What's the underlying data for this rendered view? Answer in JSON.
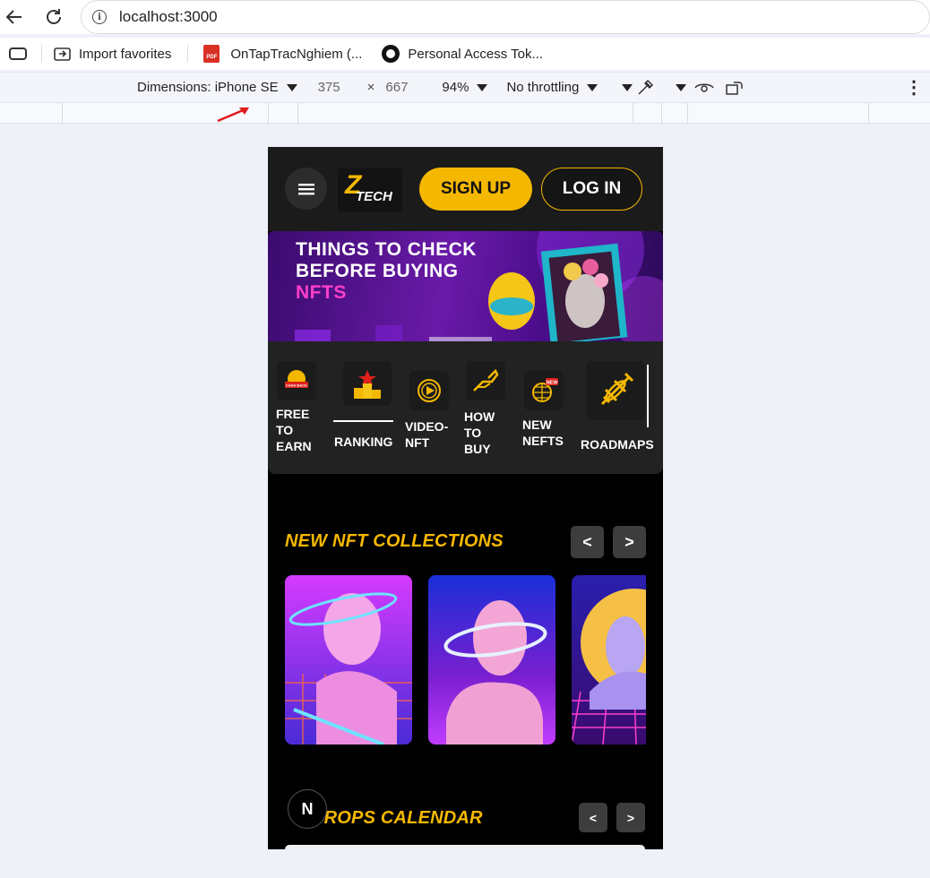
{
  "browser": {
    "url": "localhost:3000",
    "favorites": [
      "Import favorites",
      "OnTapTracNghiem (...",
      "Personal Access Tok..."
    ]
  },
  "devtools": {
    "dimensions_label": "Dimensions: iPhone SE",
    "width": "375",
    "times": "×",
    "height": "667",
    "zoom": "94%",
    "throttling": "No throttling"
  },
  "site": {
    "logo_text": "TECH",
    "logo_letter": "Z",
    "signup_label": "SIGN UP",
    "login_label": "LOG IN",
    "banner": {
      "line1": "THINGS TO CHECK",
      "line2": "BEFORE BUYING",
      "line3": "NFTS"
    },
    "categories": [
      {
        "label": "FREE TO EARN",
        "badge": "CASH BACK"
      },
      {
        "label": "RANKING"
      },
      {
        "label": "VIDEO-NFT"
      },
      {
        "label": "HOW TO BUY"
      },
      {
        "label": "NEW NEFTS",
        "badge": "NEW"
      },
      {
        "label": "ROADMAPS"
      }
    ],
    "new_collections_title": "NEW NFT COLLECTIONS",
    "drops_title_visible": "DROPS CALENDAR",
    "prev_label": "<",
    "next_label": ">",
    "fab_label": "N"
  },
  "colors": {
    "accent": "#f5b800",
    "header_bg": "#1b1b1b",
    "page_bg": "#000000",
    "pink": "#ff3fc9"
  }
}
